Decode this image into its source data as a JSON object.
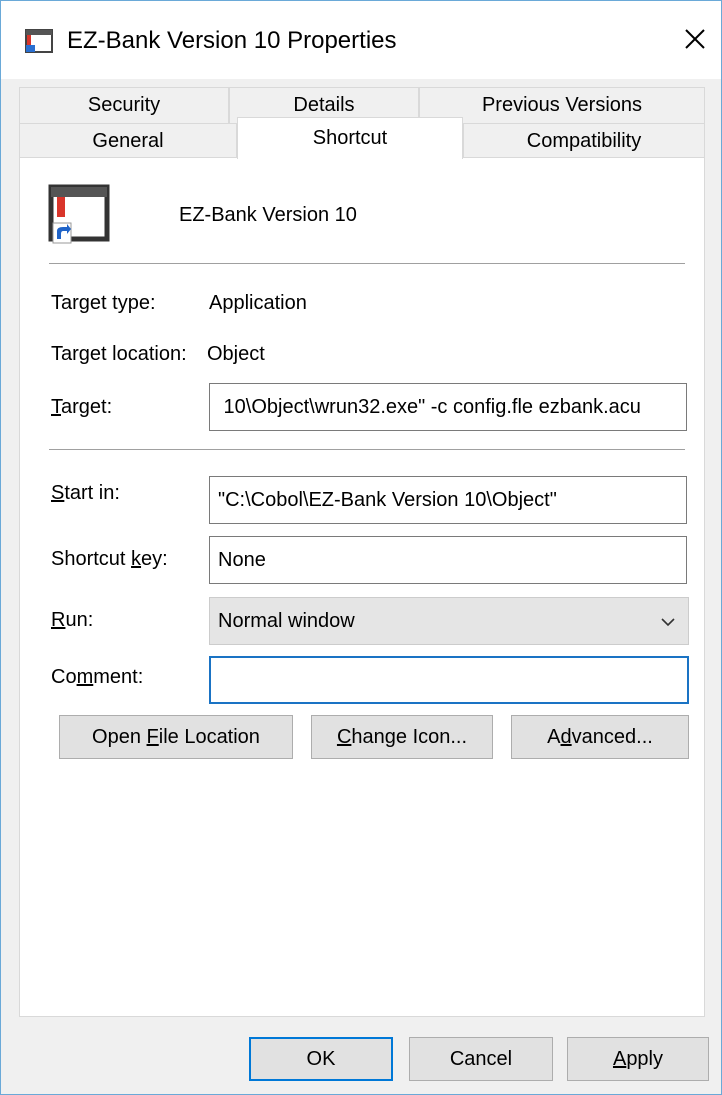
{
  "window": {
    "title": "EZ-Bank Version 10 Properties",
    "close_glyph": "✕"
  },
  "tabs": {
    "row_back": [
      {
        "label": "Security"
      },
      {
        "label": "Details"
      },
      {
        "label": "Previous Versions"
      }
    ],
    "row_front": [
      {
        "label": "General"
      },
      {
        "label": "Shortcut"
      },
      {
        "label": "Compatibility"
      }
    ],
    "active": "Shortcut"
  },
  "shortcut": {
    "name": "EZ-Bank Version 10",
    "target_type_label": "Target type:",
    "target_type_value": "Application",
    "target_location_label": "Target location:",
    "target_location_value": "Object",
    "target": {
      "label_prefix": "",
      "label_mnemonic": "T",
      "label_rest": "arget:",
      "value": " 10\\Object\\wrun32.exe\" -c config.fle ezbank.acu"
    },
    "start_in": {
      "label_mnemonic": "S",
      "label_rest": "tart in:",
      "value": "\"C:\\Cobol\\EZ-Bank Version 10\\Object\""
    },
    "shortcut_key": {
      "label_prefix": "Shortcut ",
      "label_mnemonic": "k",
      "label_rest": "ey:",
      "value": "None"
    },
    "run": {
      "label_mnemonic": "R",
      "label_rest": "un:",
      "value": "Normal window"
    },
    "comment": {
      "label_prefix": "Co",
      "label_mnemonic": "m",
      "label_rest": "ment:",
      "value": ""
    }
  },
  "buttons": {
    "open_file_location": {
      "prefix": "Open ",
      "mnemonic": "F",
      "rest": "ile Location"
    },
    "change_icon": {
      "prefix": "",
      "mnemonic": "C",
      "rest": "hange Icon..."
    },
    "advanced": {
      "prefix": "A",
      "mnemonic": "d",
      "rest": "vanced..."
    },
    "ok": "OK",
    "cancel": "Cancel",
    "apply": {
      "prefix": "",
      "mnemonic": "A",
      "rest": "pply"
    }
  },
  "colors": {
    "accent": "#0078d7",
    "focus_border": "#1a73c4",
    "panel_bg": "#ffffff",
    "dialog_bg": "#f0f0f0"
  }
}
